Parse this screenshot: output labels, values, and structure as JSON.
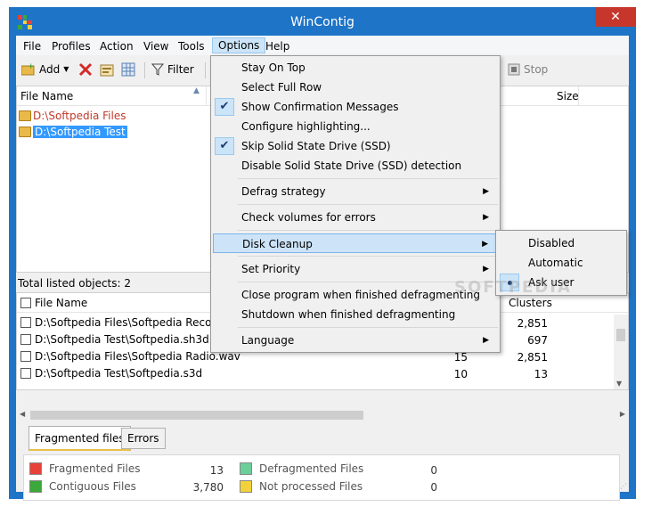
{
  "window": {
    "title": "WinContig",
    "close_glyph": "✕"
  },
  "menubar": {
    "items": [
      "File",
      "Profiles",
      "Action",
      "View",
      "Tools",
      "Options",
      "Help"
    ],
    "active": "Options"
  },
  "toolbar": {
    "add_label": "Add",
    "filter_label": "Filter",
    "stop_label": "Stop"
  },
  "top_panel": {
    "col_file_name": "File Name",
    "col_size": "Size",
    "items": [
      {
        "label": "D:\\Softpedia Files",
        "color": "#c0392b",
        "selected": false
      },
      {
        "label": "D:\\Softpedia Test",
        "color": "#1e5aa8",
        "selected": true
      }
    ],
    "status": "Total listed objects: 2"
  },
  "bottom_panel": {
    "col_file_name": "File Name",
    "col_clusters": "Clusters",
    "rows": [
      {
        "file": "D:\\Softpedia Files\\Softpedia Recording",
        "frags": "",
        "clusters": "2,851"
      },
      {
        "file": "D:\\Softpedia Test\\Softpedia.sh3d",
        "frags": "",
        "clusters": "697"
      },
      {
        "file": "D:\\Softpedia Files\\Softpedia Radio.wav",
        "frags": "15",
        "clusters": "2,851"
      },
      {
        "file": "D:\\Softpedia Test\\Softpedia.s3d",
        "frags": "10",
        "clusters": "13"
      }
    ]
  },
  "tabs": [
    {
      "label": "Fragmented files",
      "active": true
    },
    {
      "label": "Errors",
      "active": false
    }
  ],
  "legend": [
    {
      "label": "Fragmented Files",
      "value": "13",
      "color": "#e8413a"
    },
    {
      "label": "Contiguous Files",
      "value": "3,780",
      "color": "#3aa83a"
    },
    {
      "label": "Defragmented Files",
      "value": "0",
      "color": "#6ccf9a"
    },
    {
      "label": "Not processed Files",
      "value": "0",
      "color": "#f2d23a"
    }
  ],
  "options_menu": {
    "items": [
      {
        "label": "Stay On Top",
        "checked": false
      },
      {
        "label": "Select Full Row",
        "checked": false
      },
      {
        "label": "Show Confirmation Messages",
        "checked": true
      },
      {
        "label": "Configure highlighting...",
        "checked": false
      },
      {
        "label": "Skip Solid State Drive (SSD)",
        "checked": true
      },
      {
        "label": "Disable Solid State Drive (SSD) detection",
        "checked": false
      },
      {
        "label": "Defrag strategy",
        "submenu": true
      },
      {
        "label": "Check volumes for errors",
        "submenu": true
      },
      {
        "label": "Disk Cleanup",
        "submenu": true,
        "highlighted": true
      },
      {
        "label": "Set Priority",
        "submenu": true
      },
      {
        "label": "Close program when finished defragmenting"
      },
      {
        "label": "Shutdown when finished defragmenting"
      },
      {
        "label": "Language",
        "submenu": true
      }
    ],
    "check_glyph": "✔",
    "arrow_glyph": "▶"
  },
  "disk_cleanup_submenu": {
    "items": [
      {
        "label": "Disabled",
        "selected": false
      },
      {
        "label": "Automatic",
        "selected": false
      },
      {
        "label": "Ask user",
        "selected": true
      }
    ]
  },
  "watermark": "SOFTPEDIA"
}
